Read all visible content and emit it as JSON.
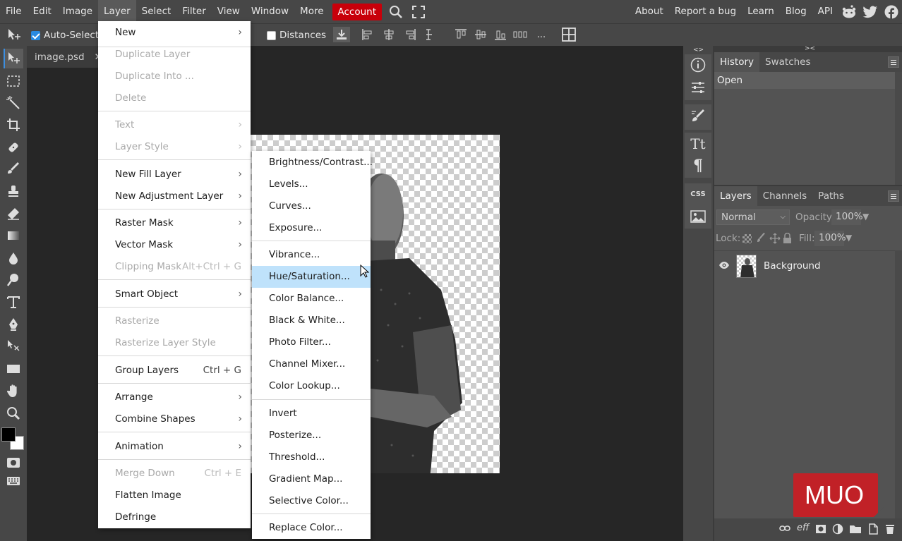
{
  "menubar": {
    "items": [
      "File",
      "Edit",
      "Image",
      "Layer",
      "Select",
      "Filter",
      "View",
      "Window",
      "More"
    ],
    "account": "Account",
    "right_links": [
      "About",
      "Report a bug",
      "Learn",
      "Blog",
      "API"
    ]
  },
  "options": {
    "auto_select": "Auto-Select",
    "distances": "Distances",
    "more": "..."
  },
  "document_tab": {
    "name": "image.psd",
    "close": "✕"
  },
  "layer_menu": {
    "items": [
      {
        "label": "New",
        "submenu": true,
        "disabled": false
      },
      {
        "label": "Duplicate Layer",
        "disabled": true
      },
      {
        "label": "Duplicate Into ...",
        "disabled": true
      },
      {
        "label": "Delete",
        "disabled": true
      },
      {
        "label": "Text",
        "submenu": true,
        "disabled": true
      },
      {
        "label": "Layer Style",
        "submenu": true,
        "disabled": true
      },
      {
        "label": "New Fill Layer",
        "submenu": true,
        "disabled": false
      },
      {
        "label": "New Adjustment Layer",
        "submenu": true,
        "disabled": false
      },
      {
        "label": "Raster Mask",
        "submenu": true,
        "disabled": false
      },
      {
        "label": "Vector Mask",
        "submenu": true,
        "disabled": false
      },
      {
        "label": "Clipping Mask",
        "shortcut": "Alt+Ctrl + G",
        "disabled": true
      },
      {
        "label": "Smart Object",
        "submenu": true,
        "disabled": false
      },
      {
        "label": "Rasterize",
        "disabled": true
      },
      {
        "label": "Rasterize Layer Style",
        "disabled": true
      },
      {
        "label": "Group Layers",
        "shortcut": "Ctrl + G",
        "disabled": false
      },
      {
        "label": "Arrange",
        "submenu": true,
        "disabled": false
      },
      {
        "label": "Combine Shapes",
        "submenu": true,
        "disabled": false
      },
      {
        "label": "Animation",
        "submenu": true,
        "disabled": false
      },
      {
        "label": "Merge Down",
        "shortcut": "Ctrl + E",
        "disabled": true
      },
      {
        "label": "Flatten Image",
        "disabled": false
      },
      {
        "label": "Defringe",
        "disabled": false
      }
    ]
  },
  "adjustment_submenu": {
    "items": [
      "Brightness/Contrast...",
      "Levels...",
      "Curves...",
      "Exposure...",
      "Vibrance...",
      "Hue/Saturation...",
      "Color Balance...",
      "Black & White...",
      "Photo Filter...",
      "Channel Mixer...",
      "Color Lookup...",
      "Invert",
      "Posterize...",
      "Threshold...",
      "Gradient Map...",
      "Selective Color...",
      "Replace Color..."
    ],
    "highlighted": "Hue/Saturation..."
  },
  "history_panel": {
    "tabs": [
      "History",
      "Swatches"
    ],
    "entries": [
      "Open"
    ]
  },
  "layers_panel": {
    "tabs": [
      "Layers",
      "Channels",
      "Paths"
    ],
    "blend_mode": "Normal",
    "opacity_label": "Opacity:",
    "opacity_value": "100%",
    "lock_label": "Lock:",
    "fill_label": "Fill:",
    "fill_value": "100%",
    "layers": [
      {
        "name": "Background",
        "visible": true
      }
    ],
    "footer_text": "eff"
  },
  "icon_column": {
    "css_label": "CSS",
    "text_label": "Tt",
    "para_label": "¶"
  },
  "watermark": {
    "text": "MUO"
  }
}
